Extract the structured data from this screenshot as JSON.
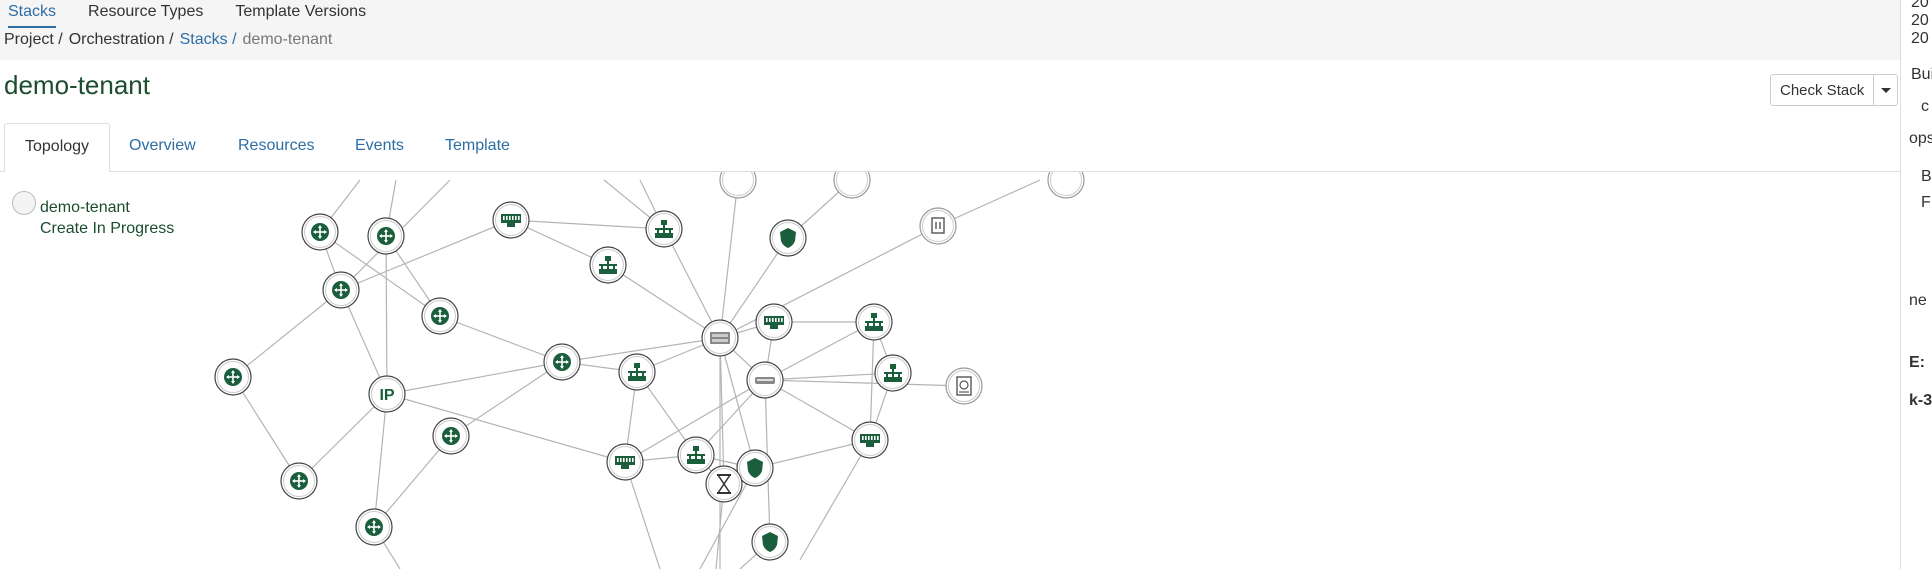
{
  "top_tabs": [
    "Stacks",
    "Resource Types",
    "Template Versions"
  ],
  "breadcrumb": {
    "project": "Project /",
    "orchestration": "Orchestration /",
    "stacks": "Stacks /",
    "current": "demo-tenant"
  },
  "page_title": "demo-tenant",
  "check_button": "Check Stack",
  "tabs": [
    "Topology",
    "Overview",
    "Resources",
    "Events",
    "Template"
  ],
  "topology": {
    "stack_name": "demo-tenant",
    "stack_status": "Create In Progress",
    "ip_label": "IP"
  },
  "right_pane": [
    "20",
    "20",
    "20",
    "Bui",
    "c",
    "ops",
    "B",
    "F",
    "ne",
    "E:",
    "k-3"
  ],
  "colors": {
    "accent": "#2e6da4",
    "node": "#1b5e3b",
    "edge": "#b4b4b4"
  }
}
